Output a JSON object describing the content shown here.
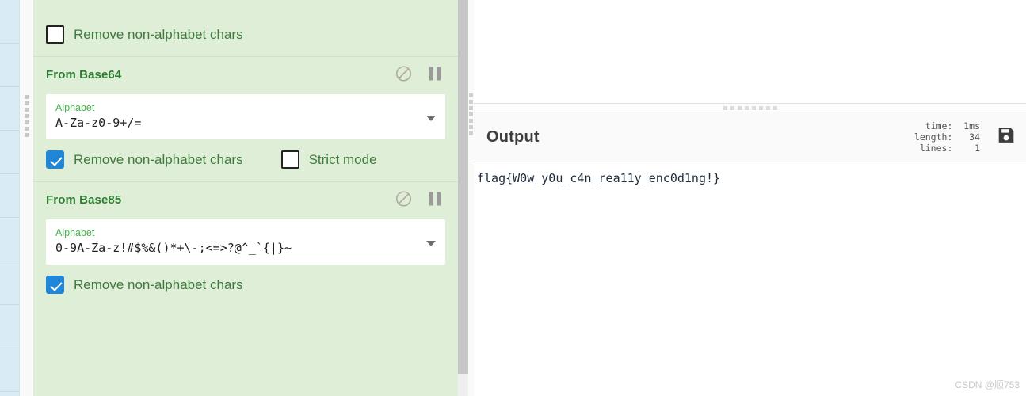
{
  "recipe": {
    "operations": [
      {
        "title": "",
        "title_visible": false,
        "icons": {
          "disable": "no-entry-icon",
          "pause": "pause-icon"
        },
        "args": [],
        "checkboxes": [
          {
            "label": "Remove non-alphabet chars",
            "checked": false
          }
        ]
      },
      {
        "title": "From Base64",
        "title_visible": true,
        "icons": {
          "disable": "no-entry-icon",
          "pause": "pause-icon"
        },
        "args": [
          {
            "label": "Alphabet",
            "value": "A-Za-z0-9+/="
          }
        ],
        "checkboxes": [
          {
            "label": "Remove non-alphabet chars",
            "checked": true
          },
          {
            "label": "Strict mode",
            "checked": false
          }
        ]
      },
      {
        "title": "From Base85",
        "title_visible": true,
        "icons": {
          "disable": "no-entry-icon",
          "pause": "pause-icon"
        },
        "args": [
          {
            "label": "Alphabet",
            "value": "0-9A-Za-z!#$%&()*+\\-;<=>?@^_`{|}~"
          }
        ],
        "checkboxes": [
          {
            "label": "Remove non-alphabet chars",
            "checked": true
          }
        ]
      }
    ]
  },
  "output": {
    "title": "Output",
    "stats": {
      "time_label": "time:",
      "time_value": "1ms",
      "length_label": "length:",
      "length_value": "34",
      "lines_label": "lines:",
      "lines_value": "1",
      "line_time": "  time:  1ms",
      "line_length": "length:   34",
      "line_lines": " lines:    1"
    },
    "save_icon": "save-disk-icon",
    "text": "flag{W0w_y0u_c4n_rea11y_enc0d1ng!}"
  },
  "watermark": {
    "text": "CSDN @顺753"
  },
  "colors": {
    "operation_bg": "#dfeed6",
    "operation_title": "#2e7d32",
    "arg_label": "#4caf50",
    "checkbox_checked": "#2185d8",
    "checkbox_label": "#3f7a3f",
    "output_text": "#1b2b3a",
    "ops_list_stripe": "#d9ecf5"
  }
}
